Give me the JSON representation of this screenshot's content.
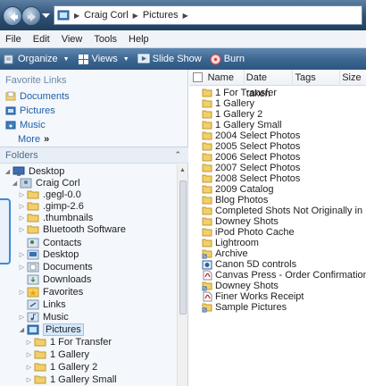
{
  "address": {
    "segments": [
      "Craig Corl",
      "Pictures"
    ]
  },
  "menu": [
    "File",
    "Edit",
    "View",
    "Tools",
    "Help"
  ],
  "commands": [
    {
      "label": "Organize",
      "icon": "organize-icon",
      "dropdown": true
    },
    {
      "label": "Views",
      "icon": "views-icon",
      "dropdown": true
    },
    {
      "label": "Slide Show",
      "icon": "slideshow-icon",
      "dropdown": false
    },
    {
      "label": "Burn",
      "icon": "burn-icon",
      "dropdown": false
    }
  ],
  "favorites": {
    "title": "Favorite Links",
    "items": [
      {
        "label": "Documents",
        "icon": "documents-icon"
      },
      {
        "label": "Pictures",
        "icon": "pictures-icon"
      },
      {
        "label": "Music",
        "icon": "music-icon"
      }
    ],
    "more": "More"
  },
  "folders": {
    "title": "Folders",
    "tree": [
      {
        "label": "Desktop",
        "icon": "desktop-icon"
      },
      {
        "label": "Craig Corl",
        "icon": "user-folder-icon"
      },
      {
        "label": ".gegl-0.0",
        "icon": "folder-icon"
      },
      {
        "label": ".gimp-2.6",
        "icon": "folder-icon"
      },
      {
        "label": ".thumbnails",
        "icon": "folder-icon"
      },
      {
        "label": "Bluetooth Software",
        "icon": "folder-icon"
      },
      {
        "label": "Contacts",
        "icon": "contacts-icon"
      },
      {
        "label": "Desktop",
        "icon": "desktop-folder-icon"
      },
      {
        "label": "Documents",
        "icon": "documents-icon"
      },
      {
        "label": "Downloads",
        "icon": "downloads-icon"
      },
      {
        "label": "Favorites",
        "icon": "favorites-icon"
      },
      {
        "label": "Links",
        "icon": "links-icon"
      },
      {
        "label": "Music",
        "icon": "music-icon"
      },
      {
        "label": "Pictures",
        "icon": "pictures-icon"
      },
      {
        "label": "1 For Transfer",
        "icon": "folder-icon"
      },
      {
        "label": "1 Gallery",
        "icon": "folder-icon"
      },
      {
        "label": "1 Gallery 2",
        "icon": "folder-icon"
      },
      {
        "label": "1 Gallery Small",
        "icon": "folder-icon"
      }
    ]
  },
  "columns": [
    "Name",
    "Date taken",
    "Tags",
    "Size"
  ],
  "files": [
    {
      "name": "1 For Transfer",
      "icon": "folder-icon"
    },
    {
      "name": "1 Gallery",
      "icon": "folder-icon"
    },
    {
      "name": "1 Gallery 2",
      "icon": "folder-icon"
    },
    {
      "name": "1 Gallery Small",
      "icon": "folder-icon"
    },
    {
      "name": "2004 Select Photos",
      "icon": "folder-icon"
    },
    {
      "name": "2005 Select Photos",
      "icon": "folder-icon"
    },
    {
      "name": "2006 Select Photos",
      "icon": "folder-icon"
    },
    {
      "name": "2007 Select Photos",
      "icon": "folder-icon"
    },
    {
      "name": "2008 Select Photos",
      "icon": "folder-icon"
    },
    {
      "name": "2009 Catalog",
      "icon": "folder-icon"
    },
    {
      "name": "Blog Photos",
      "icon": "folder-icon"
    },
    {
      "name": "Completed Shots Not Originally in LR",
      "icon": "folder-icon"
    },
    {
      "name": "Downey Shots",
      "icon": "folder-icon"
    },
    {
      "name": "iPod Photo Cache",
      "icon": "folder-icon"
    },
    {
      "name": "Lightroom",
      "icon": "folder-icon"
    },
    {
      "name": "Archive",
      "icon": "shortcut-folder-icon"
    },
    {
      "name": "Canon 5D controls",
      "icon": "image-file-icon"
    },
    {
      "name": "Canvas Press - Order Confirmation",
      "icon": "pdf-icon"
    },
    {
      "name": "Downey Shots",
      "icon": "shortcut-folder-icon"
    },
    {
      "name": "Finer Works Receipt",
      "icon": "pdf-icon"
    },
    {
      "name": "Sample Pictures",
      "icon": "shortcut-folder-icon"
    }
  ]
}
